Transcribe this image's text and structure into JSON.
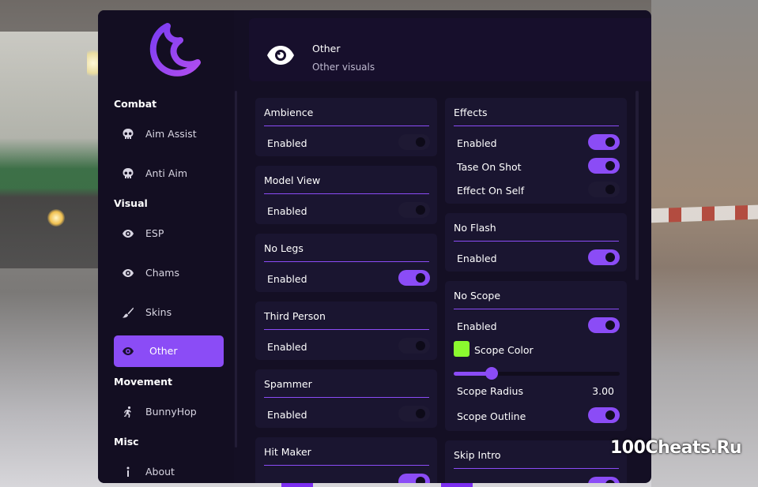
{
  "header": {
    "title": "Other",
    "subtitle": "Other visuals"
  },
  "sidebar": {
    "sections": {
      "combat": "Combat",
      "visual": "Visual",
      "movement": "Movement",
      "misc": "Misc"
    },
    "items": [
      {
        "label": "Aim Assist",
        "icon": "skull-icon"
      },
      {
        "label": "Anti Aim",
        "icon": "skull-icon"
      },
      {
        "label": "ESP",
        "icon": "eye-icon"
      },
      {
        "label": "Chams",
        "icon": "eye-icon"
      },
      {
        "label": "Skins",
        "icon": "brush-icon"
      },
      {
        "label": "Other",
        "icon": "eye-icon",
        "active": true
      },
      {
        "label": "BunnyHop",
        "icon": "running-icon"
      },
      {
        "label": "About",
        "icon": "info-icon"
      }
    ]
  },
  "left_column": [
    {
      "title": "Ambience",
      "rows": [
        {
          "label": "Enabled",
          "on": false
        }
      ]
    },
    {
      "title": "Model View",
      "rows": [
        {
          "label": "Enabled",
          "on": false
        }
      ]
    },
    {
      "title": "No Legs",
      "rows": [
        {
          "label": "Enabled",
          "on": true
        }
      ]
    },
    {
      "title": "Third Person",
      "rows": [
        {
          "label": "Enabled",
          "on": false
        }
      ]
    },
    {
      "title": "Spammer",
      "rows": [
        {
          "label": "Enabled",
          "on": false
        }
      ]
    },
    {
      "title": "Hit Maker",
      "rows": []
    }
  ],
  "right_column": {
    "effects": {
      "title": "Effects",
      "rows": [
        {
          "label": "Enabled",
          "on": true
        },
        {
          "label": "Tase On Shot",
          "on": true
        },
        {
          "label": "Effect On Self",
          "on": false
        }
      ]
    },
    "no_flash": {
      "title": "No Flash",
      "rows": [
        {
          "label": "Enabled",
          "on": true
        }
      ]
    },
    "no_scope": {
      "title": "No Scope",
      "enabled_label": "Enabled",
      "enabled_on": true,
      "color_label": "Scope Color",
      "color_value": "#8bfa2f",
      "radius_label": "Scope Radius",
      "radius_value": "3.00",
      "radius_fraction": 0.23,
      "outline_label": "Scope Outline",
      "outline_on": true
    },
    "skip_intro": {
      "title": "Skip Intro"
    }
  },
  "watermark": "100Cheats.Ru",
  "colors": {
    "accent": "#8b4cf6",
    "panel": "#140f24",
    "card": "#1a1530",
    "scope_color": "#8bfa2f"
  }
}
